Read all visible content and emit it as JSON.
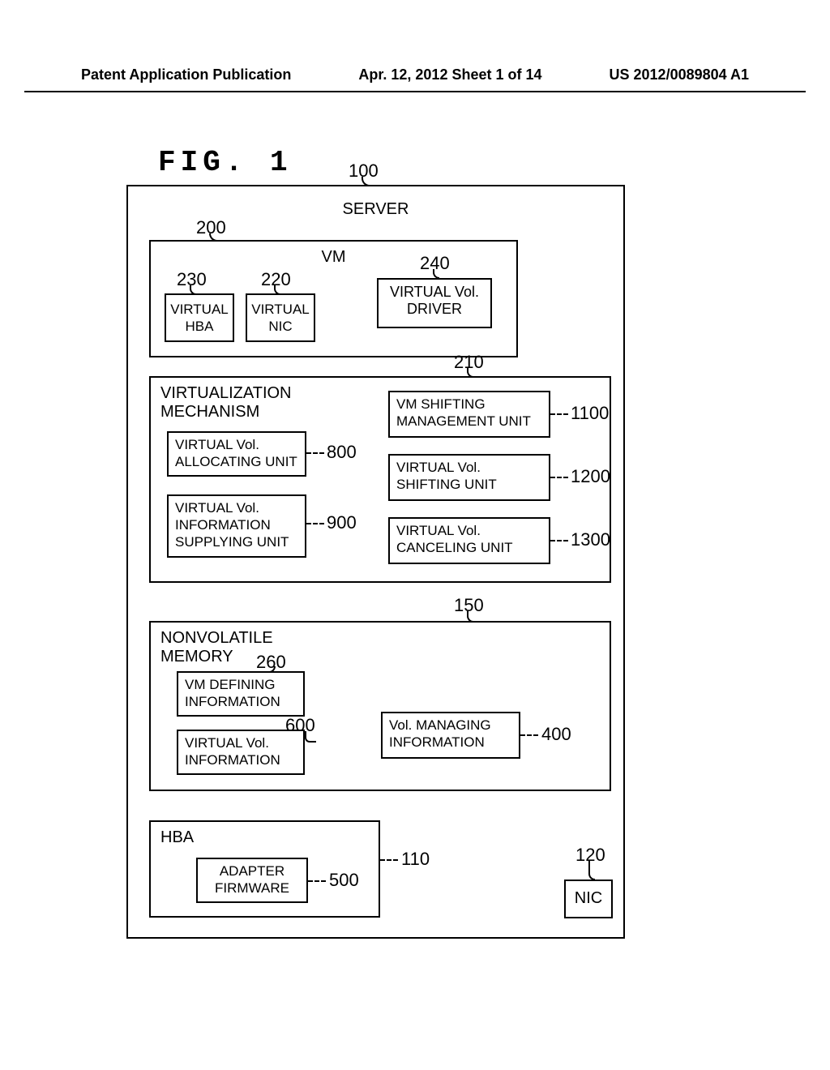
{
  "header": {
    "left": "Patent Application Publication",
    "center": "Apr. 12, 2012  Sheet 1 of 14",
    "right": "US 2012/0089804 A1"
  },
  "figure_label": "FIG. 1",
  "refs": {
    "server": "100",
    "vm": "200",
    "virt_mech": "210",
    "virtual_nic": "220",
    "virtual_hba": "230",
    "vvol_driver": "240",
    "vm_def": "260",
    "nvmem": "150",
    "vvol_info": "600",
    "alloc_unit": "800",
    "sup_unit": "900",
    "shift_mgmt": "1100",
    "shift_unit": "1200",
    "cancel_unit": "1300",
    "vol_mgmt": "400",
    "hba": "110",
    "fw": "500",
    "nic": "120"
  },
  "labels": {
    "server": "SERVER",
    "vm": "VM",
    "virtual_hba": "VIRTUAL\nHBA",
    "virtual_nic": "VIRTUAL\nNIC",
    "vvol_driver": "VIRTUAL Vol.\nDRIVER",
    "virt_mech": "VIRTUALIZATION\nMECHANISM",
    "alloc_unit": "VIRTUAL Vol.\nALLOCATING UNIT",
    "sup_unit": "VIRTUAL Vol.\nINFORMATION\nSUPPLYING UNIT",
    "shift_mgmt": "VM SHIFTING\nMANAGEMENT UNIT",
    "shift_unit": "VIRTUAL Vol.\nSHIFTING UNIT",
    "cancel_unit": "VIRTUAL Vol.\nCANCELING UNIT",
    "nvmem": "NONVOLATILE\nMEMORY",
    "vm_def": "VM DEFINING\nINFORMATION",
    "vvol_info": "VIRTUAL Vol.\nINFORMATION",
    "vol_mgmt": "Vol. MANAGING\nINFORMATION",
    "hba": "HBA",
    "fw": "ADAPTER\nFIRMWARE",
    "nic": "NIC"
  }
}
